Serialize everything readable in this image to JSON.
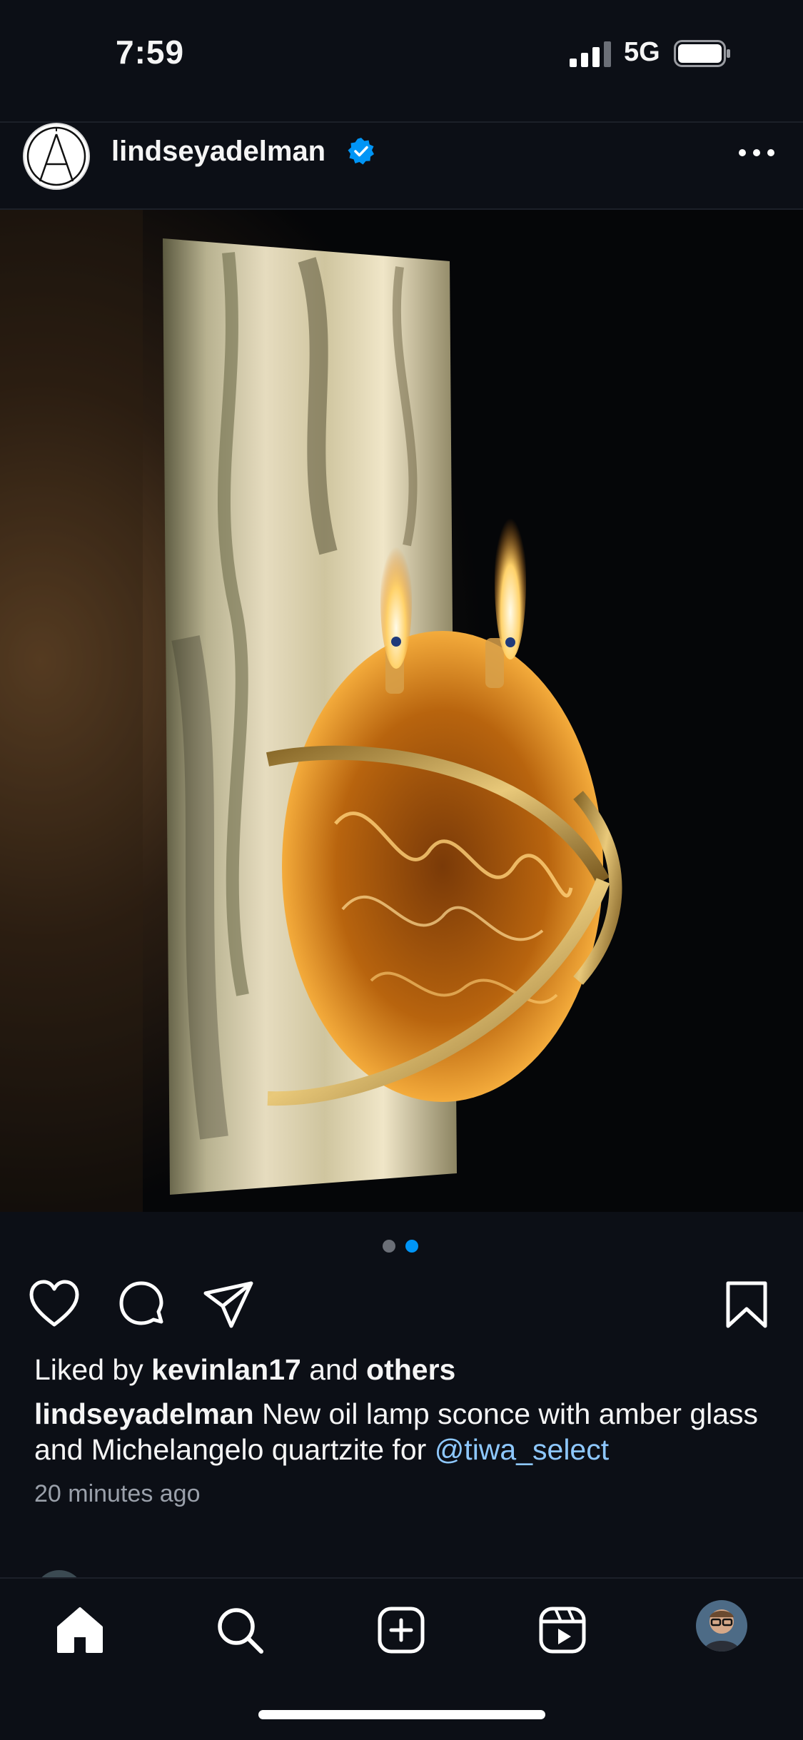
{
  "status_bar": {
    "time": "7:59",
    "network": "5G"
  },
  "post": {
    "username": "lindseyadelman",
    "verified": true,
    "image_description_icon": "photo",
    "carousel": {
      "count": 2,
      "active_index": 1
    },
    "likes": {
      "prefix": "Liked by",
      "user": "kevinlan17",
      "middle": "and",
      "others": "others"
    },
    "caption": {
      "username": "lindseyadelman",
      "text": "New oil lamp sconce with amber glass and Michelangelo quartzite for",
      "mention": "@tiwa_select"
    },
    "timestamp": "20 minutes ago"
  },
  "actions": {
    "like_icon": "heart-icon",
    "comment_icon": "comment-icon",
    "share_icon": "send-icon",
    "save_icon": "bookmark-icon"
  },
  "tab_bar": {
    "items": [
      "home-icon",
      "search-icon",
      "create-icon",
      "reels-icon",
      "profile-avatar"
    ]
  },
  "colors": {
    "background": "#0c0f16",
    "accent_blue": "#0095f6",
    "mention": "#8ec8ff",
    "muted_text": "#9aa0aa"
  }
}
